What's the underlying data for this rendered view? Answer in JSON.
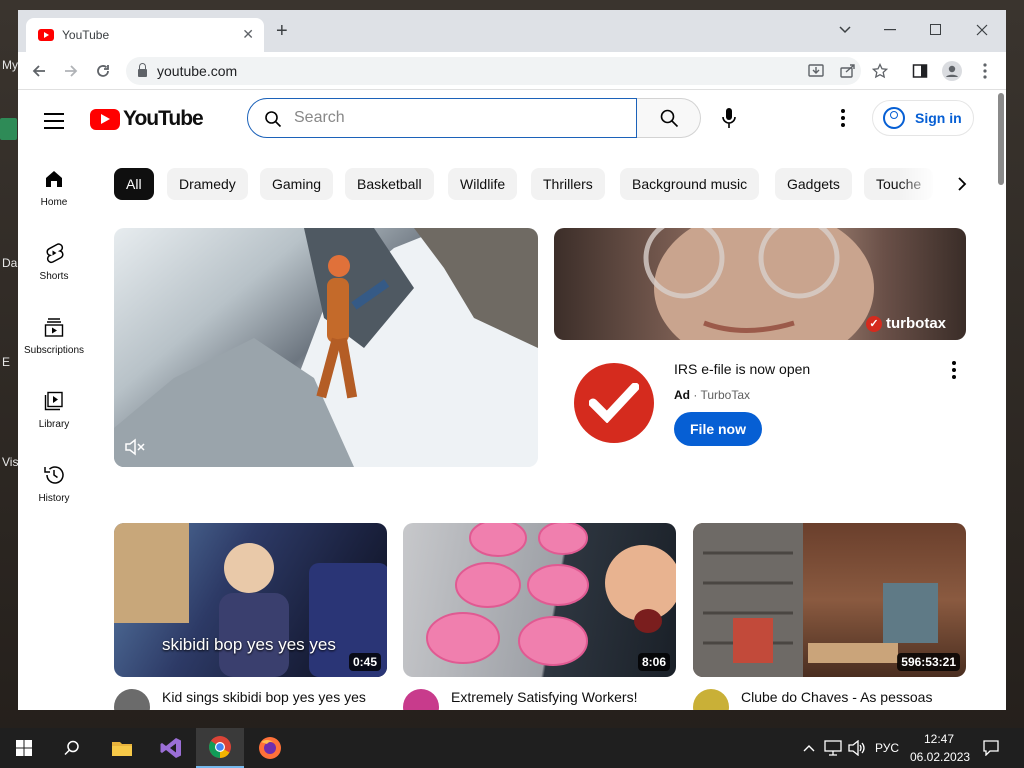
{
  "desktop": {
    "labels": [
      "My",
      "Da",
      "E",
      "Vis"
    ]
  },
  "browser": {
    "tab_title": "YouTube",
    "tab_close": "✕",
    "new_tab": "+",
    "window_controls": {
      "dropdown": "⌄",
      "minimize": "—",
      "maximize": "☐",
      "close": "✕"
    },
    "address": "youtube.com"
  },
  "youtube": {
    "logo_text": "YouTube",
    "search": {
      "placeholder": "Search"
    },
    "sign_in": "Sign in",
    "sidebar": [
      {
        "label": "Home",
        "icon": "home-icon"
      },
      {
        "label": "Shorts",
        "icon": "shorts-icon"
      },
      {
        "label": "Subscriptions",
        "icon": "subscriptions-icon"
      },
      {
        "label": "Library",
        "icon": "library-icon"
      },
      {
        "label": "History",
        "icon": "history-icon"
      }
    ],
    "chips": [
      "All",
      "Dramedy",
      "Gaming",
      "Basketball",
      "Wildlife",
      "Thrillers",
      "Background music",
      "Gadgets",
      "Touche"
    ],
    "ad": {
      "brand_overlay": "turbotax",
      "title": "IRS e-file is now open",
      "badge": "Ad",
      "advertiser": "TurboTax",
      "cta": "File now"
    },
    "videos": [
      {
        "duration": "0:45",
        "caption": "skibidi bop yes yes yes",
        "title": "Kid sings skibidi bop yes yes yes on America's Got Talent"
      },
      {
        "duration": "8:06",
        "caption": "",
        "title": "Extremely Satisfying Workers!"
      },
      {
        "duration": "596:53:21",
        "caption": "",
        "title": "Clube do Chaves - As pessoas boas devem amar seus"
      }
    ]
  },
  "taskbar": {
    "language": "РУС",
    "time": "12:47",
    "date": "06.02.2023"
  },
  "colors": {
    "brand_red": "#ff0000",
    "link_blue": "#065fd4",
    "turbotax_red": "#d52b1e"
  }
}
